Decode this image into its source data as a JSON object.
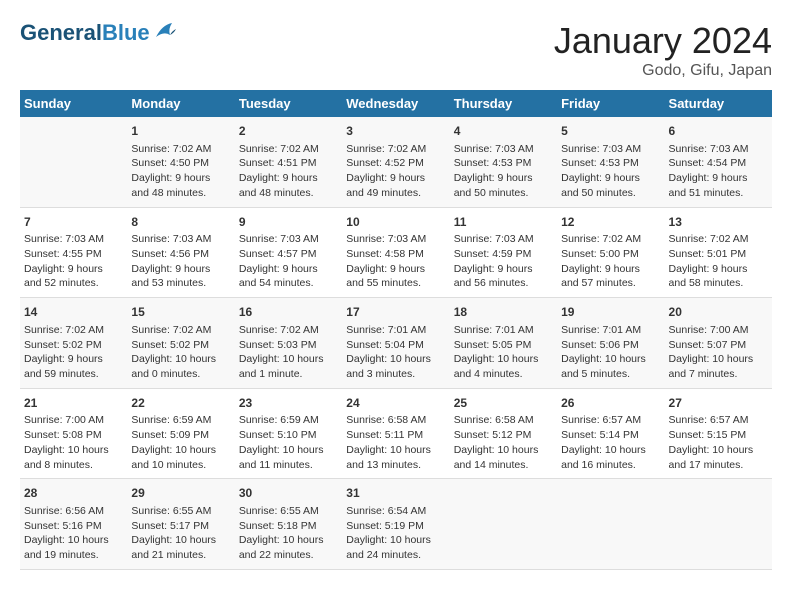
{
  "header": {
    "logo_line1": "General",
    "logo_line2": "Blue",
    "month_title": "January 2024",
    "location": "Godo, Gifu, Japan"
  },
  "days_of_week": [
    "Sunday",
    "Monday",
    "Tuesday",
    "Wednesday",
    "Thursday",
    "Friday",
    "Saturday"
  ],
  "weeks": [
    [
      {
        "day": "",
        "info": ""
      },
      {
        "day": "1",
        "info": "Sunrise: 7:02 AM\nSunset: 4:50 PM\nDaylight: 9 hours\nand 48 minutes."
      },
      {
        "day": "2",
        "info": "Sunrise: 7:02 AM\nSunset: 4:51 PM\nDaylight: 9 hours\nand 48 minutes."
      },
      {
        "day": "3",
        "info": "Sunrise: 7:02 AM\nSunset: 4:52 PM\nDaylight: 9 hours\nand 49 minutes."
      },
      {
        "day": "4",
        "info": "Sunrise: 7:03 AM\nSunset: 4:53 PM\nDaylight: 9 hours\nand 50 minutes."
      },
      {
        "day": "5",
        "info": "Sunrise: 7:03 AM\nSunset: 4:53 PM\nDaylight: 9 hours\nand 50 minutes."
      },
      {
        "day": "6",
        "info": "Sunrise: 7:03 AM\nSunset: 4:54 PM\nDaylight: 9 hours\nand 51 minutes."
      }
    ],
    [
      {
        "day": "7",
        "info": "Sunrise: 7:03 AM\nSunset: 4:55 PM\nDaylight: 9 hours\nand 52 minutes."
      },
      {
        "day": "8",
        "info": "Sunrise: 7:03 AM\nSunset: 4:56 PM\nDaylight: 9 hours\nand 53 minutes."
      },
      {
        "day": "9",
        "info": "Sunrise: 7:03 AM\nSunset: 4:57 PM\nDaylight: 9 hours\nand 54 minutes."
      },
      {
        "day": "10",
        "info": "Sunrise: 7:03 AM\nSunset: 4:58 PM\nDaylight: 9 hours\nand 55 minutes."
      },
      {
        "day": "11",
        "info": "Sunrise: 7:03 AM\nSunset: 4:59 PM\nDaylight: 9 hours\nand 56 minutes."
      },
      {
        "day": "12",
        "info": "Sunrise: 7:02 AM\nSunset: 5:00 PM\nDaylight: 9 hours\nand 57 minutes."
      },
      {
        "day": "13",
        "info": "Sunrise: 7:02 AM\nSunset: 5:01 PM\nDaylight: 9 hours\nand 58 minutes."
      }
    ],
    [
      {
        "day": "14",
        "info": "Sunrise: 7:02 AM\nSunset: 5:02 PM\nDaylight: 9 hours\nand 59 minutes."
      },
      {
        "day": "15",
        "info": "Sunrise: 7:02 AM\nSunset: 5:02 PM\nDaylight: 10 hours\nand 0 minutes."
      },
      {
        "day": "16",
        "info": "Sunrise: 7:02 AM\nSunset: 5:03 PM\nDaylight: 10 hours\nand 1 minute."
      },
      {
        "day": "17",
        "info": "Sunrise: 7:01 AM\nSunset: 5:04 PM\nDaylight: 10 hours\nand 3 minutes."
      },
      {
        "day": "18",
        "info": "Sunrise: 7:01 AM\nSunset: 5:05 PM\nDaylight: 10 hours\nand 4 minutes."
      },
      {
        "day": "19",
        "info": "Sunrise: 7:01 AM\nSunset: 5:06 PM\nDaylight: 10 hours\nand 5 minutes."
      },
      {
        "day": "20",
        "info": "Sunrise: 7:00 AM\nSunset: 5:07 PM\nDaylight: 10 hours\nand 7 minutes."
      }
    ],
    [
      {
        "day": "21",
        "info": "Sunrise: 7:00 AM\nSunset: 5:08 PM\nDaylight: 10 hours\nand 8 minutes."
      },
      {
        "day": "22",
        "info": "Sunrise: 6:59 AM\nSunset: 5:09 PM\nDaylight: 10 hours\nand 10 minutes."
      },
      {
        "day": "23",
        "info": "Sunrise: 6:59 AM\nSunset: 5:10 PM\nDaylight: 10 hours\nand 11 minutes."
      },
      {
        "day": "24",
        "info": "Sunrise: 6:58 AM\nSunset: 5:11 PM\nDaylight: 10 hours\nand 13 minutes."
      },
      {
        "day": "25",
        "info": "Sunrise: 6:58 AM\nSunset: 5:12 PM\nDaylight: 10 hours\nand 14 minutes."
      },
      {
        "day": "26",
        "info": "Sunrise: 6:57 AM\nSunset: 5:14 PM\nDaylight: 10 hours\nand 16 minutes."
      },
      {
        "day": "27",
        "info": "Sunrise: 6:57 AM\nSunset: 5:15 PM\nDaylight: 10 hours\nand 17 minutes."
      }
    ],
    [
      {
        "day": "28",
        "info": "Sunrise: 6:56 AM\nSunset: 5:16 PM\nDaylight: 10 hours\nand 19 minutes."
      },
      {
        "day": "29",
        "info": "Sunrise: 6:55 AM\nSunset: 5:17 PM\nDaylight: 10 hours\nand 21 minutes."
      },
      {
        "day": "30",
        "info": "Sunrise: 6:55 AM\nSunset: 5:18 PM\nDaylight: 10 hours\nand 22 minutes."
      },
      {
        "day": "31",
        "info": "Sunrise: 6:54 AM\nSunset: 5:19 PM\nDaylight: 10 hours\nand 24 minutes."
      },
      {
        "day": "",
        "info": ""
      },
      {
        "day": "",
        "info": ""
      },
      {
        "day": "",
        "info": ""
      }
    ]
  ]
}
